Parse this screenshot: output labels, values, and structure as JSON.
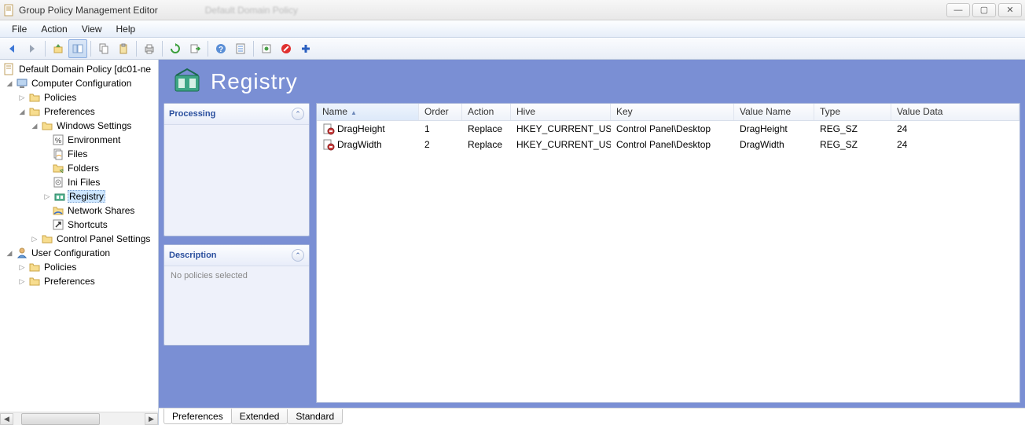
{
  "window": {
    "title": "Group Policy Management Editor",
    "blur": "Default Domain Policy"
  },
  "winControls": {
    "min": "—",
    "max": "▢",
    "close": "✕"
  },
  "menu": {
    "file": "File",
    "action": "Action",
    "view": "View",
    "help": "Help"
  },
  "tree": {
    "root": "Default Domain Policy [dc01-ne",
    "cc": "Computer Configuration",
    "policies": "Policies",
    "preferences": "Preferences",
    "ws": "Windows Settings",
    "env": "Environment",
    "files": "Files",
    "folders": "Folders",
    "ini": "Ini Files",
    "registry": "Registry",
    "netshares": "Network Shares",
    "shortcuts": "Shortcuts",
    "cps": "Control Panel Settings",
    "uc": "User Configuration",
    "upolicies": "Policies",
    "uprefs": "Preferences"
  },
  "header": {
    "title": "Registry"
  },
  "panels": {
    "processing": "Processing",
    "description": "Description",
    "descText": "No policies selected"
  },
  "columns": {
    "name": "Name",
    "order": "Order",
    "action": "Action",
    "hive": "Hive",
    "key": "Key",
    "valuename": "Value Name",
    "type": "Type",
    "valuedata": "Value Data"
  },
  "rows": [
    {
      "name": "DragHeight",
      "order": "1",
      "action": "Replace",
      "hive": "HKEY_CURRENT_USER",
      "key": "Control Panel\\Desktop",
      "valuename": "DragHeight",
      "type": "REG_SZ",
      "valuedata": "24"
    },
    {
      "name": "DragWidth",
      "order": "2",
      "action": "Replace",
      "hive": "HKEY_CURRENT_USER",
      "key": "Control Panel\\Desktop",
      "valuename": "DragWidth",
      "type": "REG_SZ",
      "valuedata": "24"
    }
  ],
  "tabs": {
    "preferences": "Preferences",
    "extended": "Extended",
    "standard": "Standard"
  }
}
